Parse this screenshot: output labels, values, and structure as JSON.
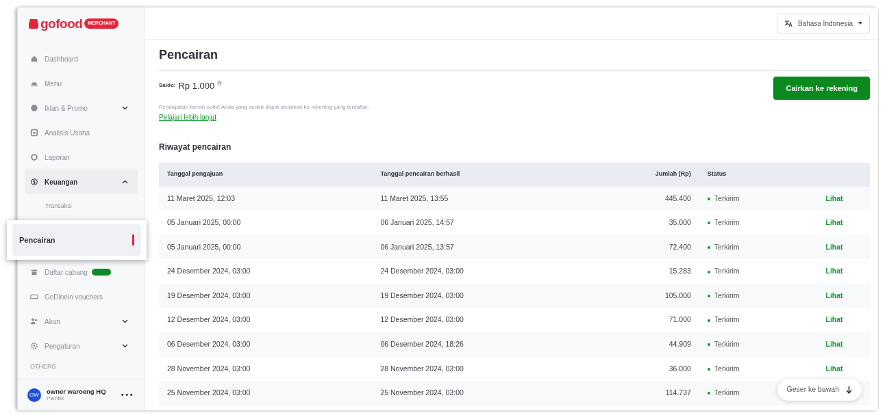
{
  "sidebar": {
    "logo": "gofood",
    "logo_badge": "MERCHANT",
    "items": [
      {
        "kind": "item",
        "label": "Dashboard",
        "selected": false
      },
      {
        "kind": "item",
        "label": "Menu",
        "selected": false
      },
      {
        "kind": "item",
        "label": "Iklan & Promo",
        "expanded": false,
        "selected": false
      },
      {
        "kind": "item",
        "label": "Analisis Usaha",
        "selected": false
      },
      {
        "kind": "item",
        "label": "Laporan",
        "selected": false
      },
      {
        "kind": "item",
        "label": "Keuangan",
        "expanded": true,
        "selected": true
      },
      {
        "kind": "subitem",
        "label": "Transaksi",
        "selected": false
      },
      {
        "kind": "subitem",
        "label": "Pencairan",
        "selected": true
      },
      {
        "kind": "item",
        "label": "Daftar cabang",
        "selected": false,
        "new_badge": true
      },
      {
        "kind": "item",
        "label": "GoDinein vouchers",
        "selected": false
      },
      {
        "kind": "item",
        "label": "Akun",
        "expanded": false,
        "selected": false
      },
      {
        "kind": "item",
        "label": "Pengaturan",
        "expanded": false,
        "selected": false
      },
      {
        "kind": "section",
        "label": "OTHERS"
      }
    ],
    "user": {
      "initials": "OW",
      "name": "owner waroeng HQ",
      "role": "Pemilik",
      "menu": "•••"
    }
  },
  "language": "Bahasa Indonesia",
  "page_title": "Pencairan",
  "balance": {
    "label": "Saldo:",
    "amount": "Rp 1.000"
  },
  "withdraw_button": "Cairkan ke rekening",
  "description": "Pendapatan bersih outlet Anda yang sudah dapat dicairkan ke rekening yang terdaftar.",
  "learn_more": "Pelajari lebih lanjut",
  "history_title": "Riwayat pencairan",
  "table": {
    "columns": [
      "Tanggal pengajuan",
      "Tanggal pencairan berhasil",
      "Jumlah (Rp)",
      "Status"
    ],
    "rows": [
      {
        "submitted": "11 Maret 2025, 12:03",
        "paid": "11 Maret 2025, 13:55",
        "amount": "445.400",
        "status": "Terkirim",
        "action": "Lihat"
      },
      {
        "submitted": "05 Januari 2025, 00:00",
        "paid": "06 Januari 2025, 14:57",
        "amount": "35.000",
        "status": "Terkirim",
        "action": "Lihat"
      },
      {
        "submitted": "05 Januari 2025, 00:00",
        "paid": "06 Januari 2025, 13:57",
        "amount": "72.400",
        "status": "Terkirim",
        "action": "Lihat"
      },
      {
        "submitted": "24 Desember 2024, 03:00",
        "paid": "24 Desember 2024, 03:00",
        "amount": "15.283",
        "status": "Terkirim",
        "action": "Lihat"
      },
      {
        "submitted": "19 Desember 2024, 03:00",
        "paid": "19 Desember 2024, 03:00",
        "amount": "105.000",
        "status": "Terkirim",
        "action": "Lihat"
      },
      {
        "submitted": "12 Desember 2024, 03:00",
        "paid": "12 Desember 2024, 03:00",
        "amount": "71.000",
        "status": "Terkirim",
        "action": "Lihat"
      },
      {
        "submitted": "06 Desember 2024, 03:00",
        "paid": "06 Desember 2024, 18:26",
        "amount": "44.909",
        "status": "Terkirim",
        "action": "Lihat"
      },
      {
        "submitted": "28 November 2024, 03:00",
        "paid": "28 November 2024, 03:00",
        "amount": "36.000",
        "status": "Terkirim",
        "action": "Lihat"
      },
      {
        "submitted": "25 November 2024, 03:00",
        "paid": "25 November 2024, 03:00",
        "amount": "114.737",
        "status": "Terkirim",
        "action": null
      }
    ]
  },
  "scroll_hint": "Geser ke bawah"
}
